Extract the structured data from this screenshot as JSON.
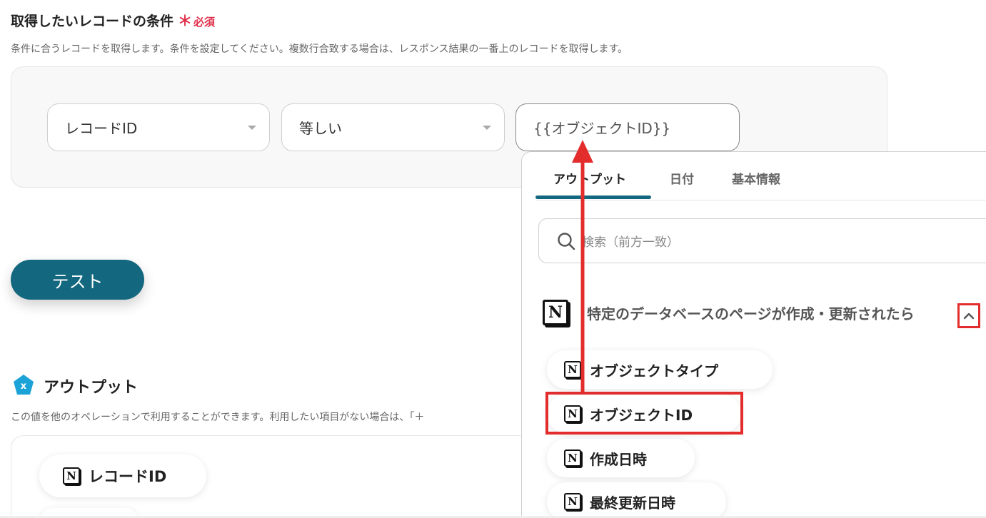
{
  "section": {
    "title": "取得したいレコードの条件",
    "required_mark": "＊",
    "required_label": "必須",
    "description": "条件に合うレコードを取得します。条件を設定してください。複数行合致する場合は、レスポンス結果の一番上のレコードを取得します。"
  },
  "condition": {
    "field_value": "レコードID",
    "operator_value": "等しい",
    "input_value": "{{オブジェクトID}}"
  },
  "test_button": {
    "label": "テスト"
  },
  "output": {
    "title": "アウトプット",
    "description": "この値を他のオペレーションで利用することができます。利用したい項目がない場合は、「＋",
    "chips": [
      {
        "label": "レコードID"
      }
    ]
  },
  "popover": {
    "tabs": [
      {
        "label": "アウトプット",
        "active": true
      },
      {
        "label": "日付",
        "active": false
      },
      {
        "label": "基本情報",
        "active": false
      }
    ],
    "search_placeholder": "検索（前方一致）",
    "group_title": "特定のデータベースのページが作成・更新されたら",
    "items": [
      {
        "label": "オブジェクトタイプ"
      },
      {
        "label": "オブジェクトID"
      },
      {
        "label": "作成日時"
      },
      {
        "label": "最終更新日時"
      }
    ]
  },
  "icons": {
    "notion": "notion-icon",
    "search": "search-icon",
    "chevron": "chevron-up-icon",
    "output": "output-x-icon"
  },
  "colors": {
    "primary": "#13677f",
    "required": "#e0314b",
    "annotation": "#e32c2c"
  }
}
